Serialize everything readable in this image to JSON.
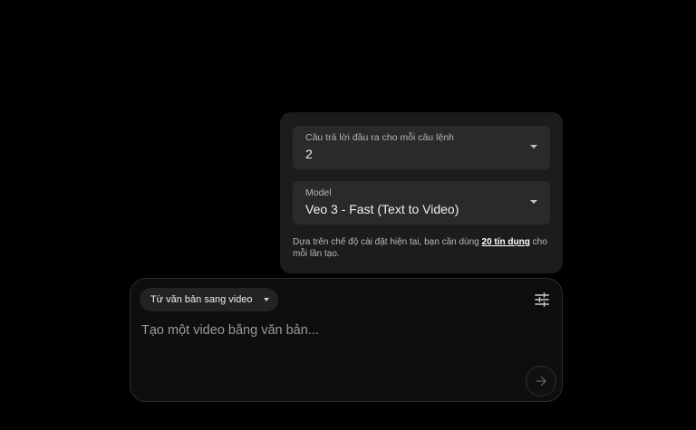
{
  "settings": {
    "outputs_field": {
      "label": "Câu trả lời đầu ra cho mỗi câu lệnh",
      "value": "2"
    },
    "model_field": {
      "label": "Model",
      "value": "Veo 3 - Fast (Text to Video)"
    },
    "credits_info": {
      "prefix": "Dựa trên chế độ cài đặt hiện tại, bạn cần dùng ",
      "link": "20 tín dụng",
      "suffix": " cho mỗi lần tạo."
    }
  },
  "composer": {
    "mode_label": "Từ văn bản sang video",
    "prompt_placeholder": "Tạo một video bằng văn bản...",
    "prompt_value": ""
  },
  "icons": {
    "settings_toggle": "tune-icon",
    "send": "arrow-right-icon",
    "dropdown": "chevron-down-icon"
  },
  "colors": {
    "background": "#000000",
    "panel": "#1c1c1e",
    "field": "#2a2a2c",
    "composer": "#0e0e0f"
  }
}
